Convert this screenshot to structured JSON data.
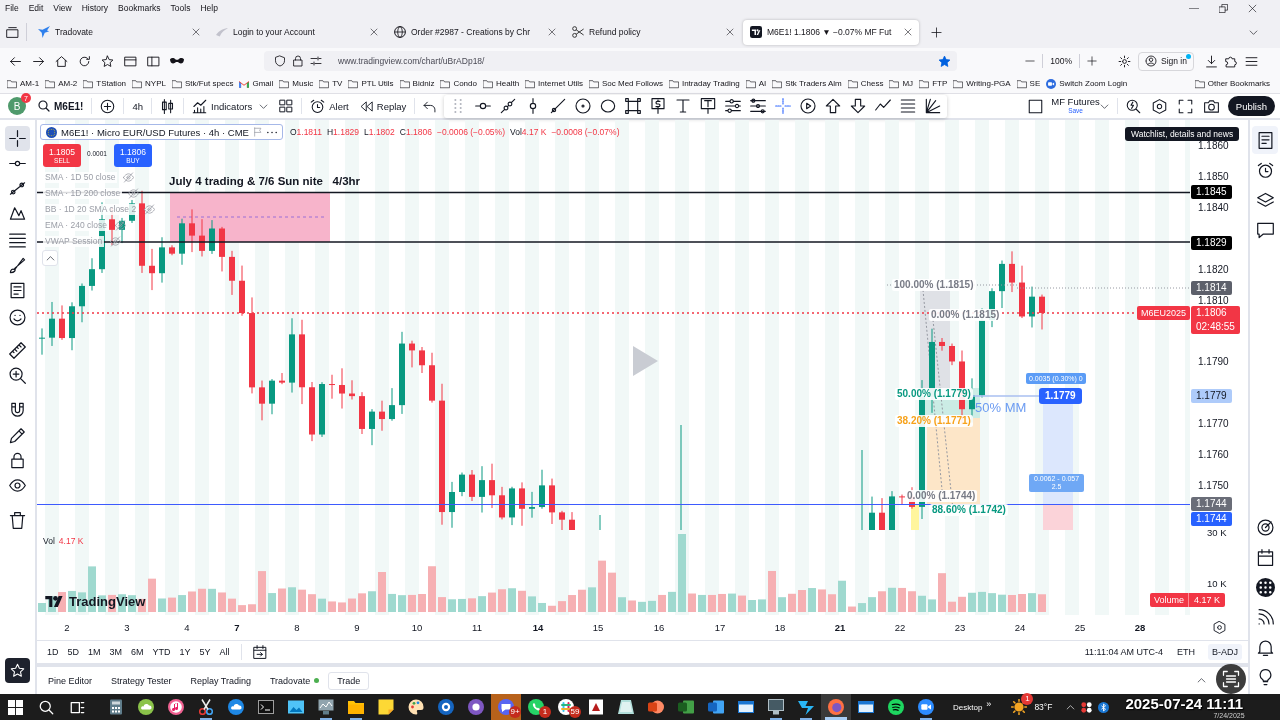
{
  "menu_bar": [
    "File",
    "Edit",
    "View",
    "History",
    "Bookmarks",
    "Tools",
    "Help"
  ],
  "browser_tabs": [
    {
      "title": "Tradovate",
      "selected": false
    },
    {
      "title": "Login to your Account",
      "selected": false
    },
    {
      "title": "Order #2987 - Creations by Chr",
      "selected": false
    },
    {
      "title": "Refund policy",
      "selected": false
    },
    {
      "title": "M6E1! 1.1806 ▼ −0.07% MF Fut",
      "selected": true
    }
  ],
  "address_bar": {
    "url": "www.tradingview.com/chart/uBrADp18/",
    "bookmarked": true
  },
  "zoom_level": "100%",
  "sign_in": {
    "label": "Sign in",
    "notification": true
  },
  "bookmarks": [
    {
      "label": "AM-1",
      "kind": "folder"
    },
    {
      "label": "AM-2",
      "kind": "folder"
    },
    {
      "label": "TStation",
      "kind": "folder"
    },
    {
      "label": "NYPL",
      "kind": "folder"
    },
    {
      "label": "Stk/Fut specs",
      "kind": "folder"
    },
    {
      "label": "Gmail",
      "kind": "mail"
    },
    {
      "label": "Music",
      "kind": "folder"
    },
    {
      "label": "TV",
      "kind": "folder"
    },
    {
      "label": "PTL Utils",
      "kind": "folder"
    },
    {
      "label": "Bidniz",
      "kind": "folder"
    },
    {
      "label": "Condo",
      "kind": "folder"
    },
    {
      "label": "Health",
      "kind": "folder"
    },
    {
      "label": "Internet Utils",
      "kind": "folder"
    },
    {
      "label": "Soc Med Follows",
      "kind": "folder"
    },
    {
      "label": "Intraday Trading",
      "kind": "folder"
    },
    {
      "label": "AI",
      "kind": "folder"
    },
    {
      "label": "Stk Traders Alm",
      "kind": "folder"
    },
    {
      "label": "Chess",
      "kind": "folder"
    },
    {
      "label": "MJ",
      "kind": "folder"
    },
    {
      "label": "FTP",
      "kind": "folder"
    },
    {
      "label": "Writing-PGA",
      "kind": "folder"
    },
    {
      "label": "SE",
      "kind": "folder"
    },
    {
      "label": "Switch Zoom Login",
      "kind": "meeting"
    }
  ],
  "other_bookmarks": "Other Bookmarks",
  "chart_toolbar": {
    "avatar": "B",
    "avatar_badge": "7",
    "symbol": "M6E1!",
    "interval": "4h",
    "indicators": "Indicators",
    "alert": "Alert",
    "replay": "Replay",
    "layout_name": "MF Futures",
    "layout_status": "Save",
    "publish": "Publish"
  },
  "left_tools": [
    {
      "selected": true
    },
    {
      "selected": false
    },
    {
      "selected": false
    },
    {
      "selected": false
    },
    {
      "selected": false
    },
    {
      "selected": false
    },
    {
      "selected": false
    },
    {
      "selected": false
    },
    {
      "selected": false
    },
    {
      "selected": false
    },
    {
      "selected": false
    },
    {
      "selected": false
    },
    {
      "selected": false
    },
    {
      "selected": false
    },
    {
      "selected": false
    }
  ],
  "chart": {
    "legend": {
      "title": "M6E1! · Micro EUR/USD Futures · 4h · CME",
      "values": [
        {
          "label": "O",
          "value": "1.1811"
        },
        {
          "label": "H",
          "value": "1.1829"
        },
        {
          "label": "L",
          "value": "1.1802"
        },
        {
          "label": "C",
          "value": "1.1806"
        }
      ],
      "change": "−0.0006 (−0.05%)",
      "volume_label": "Vol",
      "volume": "4.17 K",
      "volume_change": "−0.0008 (−0.07%)"
    },
    "trade": {
      "sell_price": "1.1805",
      "sell_label": "SELL",
      "spread": "0.0001",
      "buy_price": "1.1806",
      "buy_label": "BUY"
    },
    "indicators": [
      {
        "label": "SMA · 1D 50 close",
        "visible": false
      },
      {
        "label": "SMA · 1D 200 close",
        "visible": false
      },
      {
        "label": "BB · 1D 20 SMA close 2",
        "visible": false
      },
      {
        "label": "EMA · 240 close",
        "visible": false
      },
      {
        "label": "VWAP Session",
        "visible": false
      }
    ],
    "annotation": "July 4 trading & 7/6 Sun nite   4/3hr",
    "fib_labels": [
      {
        "text": "100.00% (1.1815)",
        "color": "#787b86"
      },
      {
        "text": "0.00% (1.1815)",
        "color": "#787b86"
      },
      {
        "text": "50.00% (1.1779)",
        "color": "#089981"
      },
      {
        "text": "38.20% (1.1771)",
        "color": "#f7a21b"
      },
      {
        "text": "0.00% (1.1744)",
        "color": "#787b86"
      },
      {
        "text": "88.60% (1.1742)",
        "color": "#089981"
      }
    ],
    "measure_label": "50% MM",
    "position": {
      "target": "0.0035 (0.30%) 0",
      "entry": "1.1779",
      "stop": [
        "0.0062 - 0.057",
        "2.5"
      ]
    },
    "price_ticks": [
      "1.1860",
      "1.1850",
      "1.1840",
      "1.1820",
      "1.1810",
      "1.1790",
      "1.1770",
      "1.1760",
      "1.1750"
    ],
    "price_tags": [
      {
        "price": "1.1845",
        "color": "#000000"
      },
      {
        "price": "1.1829",
        "color": "#000000"
      },
      {
        "price": "1.1814",
        "color": "#5d606b"
      },
      {
        "price": "1.1806",
        "countdown": "02:48:55",
        "color": "#f23645"
      },
      {
        "price": "1.1779",
        "color": "#aecbfa"
      },
      {
        "price": "1.1744",
        "color": "#6a6d78"
      },
      {
        "price": "1.1744",
        "color": "#2962ff"
      }
    ],
    "symbol_tag": "M6EU2025",
    "volume_legend": {
      "label": "Vol",
      "value": "4.17 K"
    },
    "volume_ticks": [
      "30 K",
      "10 K"
    ],
    "volume_tag": {
      "label": "Volume",
      "value": "4.17 K"
    },
    "logo": "TradingView",
    "tooltip": "Watchlist, details and news"
  },
  "time_axis": [
    {
      "label": "2",
      "kind": "day"
    },
    {
      "label": "3",
      "kind": "day"
    },
    {
      "label": "4",
      "kind": "day"
    },
    {
      "label": "7",
      "kind": "week"
    },
    {
      "label": "8",
      "kind": "day"
    },
    {
      "label": "9",
      "kind": "day"
    },
    {
      "label": "10",
      "kind": "day"
    },
    {
      "label": "11",
      "kind": "day"
    },
    {
      "label": "14",
      "kind": "week"
    },
    {
      "label": "15",
      "kind": "day"
    },
    {
      "label": "16",
      "kind": "day"
    },
    {
      "label": "17",
      "kind": "day"
    },
    {
      "label": "18",
      "kind": "day"
    },
    {
      "label": "21",
      "kind": "week"
    },
    {
      "label": "22",
      "kind": "day"
    },
    {
      "label": "23",
      "kind": "day"
    },
    {
      "label": "24",
      "kind": "day"
    },
    {
      "label": "25",
      "kind": "day"
    },
    {
      "label": "28",
      "kind": "week"
    }
  ],
  "range_buttons": [
    "1D",
    "5D",
    "1M",
    "3M",
    "6M",
    "YTD",
    "1Y",
    "5Y",
    "All"
  ],
  "session_status": {
    "time": "11:11:04 AM UTC-4",
    "toggles": [
      {
        "label": "ETH",
        "on": false
      },
      {
        "label": "B-ADJ",
        "on": true
      }
    ]
  },
  "bottom_tabs": [
    {
      "label": "Pine Editor",
      "kind": "tab"
    },
    {
      "label": "Strategy Tester",
      "kind": "tab"
    },
    {
      "label": "Replay Trading",
      "kind": "tab"
    },
    {
      "label": "Tradovate",
      "kind": "broker",
      "connected": true
    },
    {
      "label": "Trade",
      "kind": "button"
    }
  ],
  "right_panel": [
    {
      "selected": true
    },
    {
      "selected": false
    },
    {
      "selected": false
    },
    {
      "selected": false
    },
    {
      "selected": false
    },
    {
      "selected": false
    },
    {
      "selected": false
    },
    {
      "selected": false
    },
    {
      "selected": false
    },
    {
      "selected": false
    }
  ],
  "taskbar": {
    "apps": [
      {
        "running": false,
        "selected": false,
        "attention": false
      },
      {
        "running": false,
        "selected": false,
        "attention": false
      },
      {
        "running": false,
        "selected": false,
        "attention": false
      },
      {
        "running": true,
        "selected": false,
        "attention": false
      },
      {
        "running": false,
        "selected": false,
        "attention": false
      },
      {
        "running": false,
        "selected": false,
        "attention": false
      },
      {
        "running": false,
        "selected": false,
        "attention": false
      },
      {
        "running": true,
        "selected": false,
        "attention": false
      },
      {
        "running": true,
        "selected": false,
        "attention": false
      },
      {
        "running": false,
        "selected": false,
        "attention": false
      },
      {
        "running": false,
        "selected": false,
        "attention": false
      },
      {
        "running": false,
        "selected": false,
        "attention": false
      },
      {
        "running": false,
        "selected": false,
        "attention": false
      },
      {
        "running": false,
        "selected": false,
        "attention": true,
        "badge": "9+"
      },
      {
        "running": false,
        "selected": false,
        "attention": false,
        "badge": "1"
      },
      {
        "running": false,
        "selected": false,
        "attention": false,
        "badge": "59"
      },
      {
        "running": false,
        "selected": false,
        "attention": false
      },
      {
        "running": false,
        "selected": false,
        "attention": false
      },
      {
        "running": false,
        "selected": false,
        "attention": false
      },
      {
        "running": false,
        "selected": false,
        "attention": false
      },
      {
        "running": false,
        "selected": false,
        "attention": false
      },
      {
        "running": false,
        "selected": false,
        "attention": false
      },
      {
        "running": true,
        "selected": false,
        "attention": false
      },
      {
        "running": true,
        "selected": false,
        "attention": false
      },
      {
        "running": true,
        "selected": true,
        "attention": false
      },
      {
        "running": false,
        "selected": false,
        "attention": false
      },
      {
        "running": false,
        "selected": false,
        "attention": false
      },
      {
        "running": true,
        "selected": false,
        "attention": false
      }
    ],
    "desktop_label": "Desktop",
    "overflow": "»",
    "weather": {
      "temperature": "83°F",
      "badge": "1"
    },
    "clock_overlay": "2025-07-24 11:11",
    "date": "7/24/2025"
  }
}
